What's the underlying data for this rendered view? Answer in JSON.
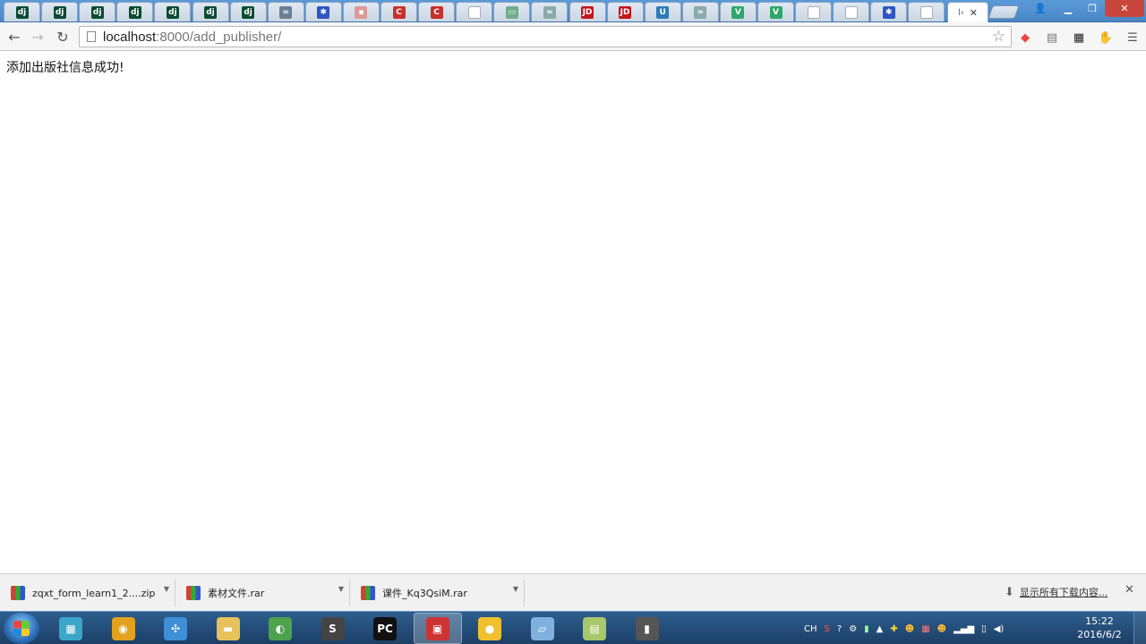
{
  "browser": {
    "tabs": [
      {
        "icon": "django-icon",
        "text": "dj",
        "color": "#0c4b33"
      },
      {
        "icon": "django-icon",
        "text": "dj",
        "color": "#0c4b33"
      },
      {
        "icon": "django-icon",
        "text": "dj",
        "color": "#0c4b33"
      },
      {
        "icon": "django-icon",
        "text": "dj",
        "color": "#0c4b33"
      },
      {
        "icon": "django-icon",
        "text": "dj",
        "color": "#0c4b33"
      },
      {
        "icon": "django-icon",
        "text": "dj",
        "color": "#0c4b33"
      },
      {
        "icon": "django-icon",
        "text": "dj",
        "color": "#0c4b33"
      },
      {
        "icon": "link-icon",
        "text": "∞",
        "color": "#6a7f96"
      },
      {
        "icon": "baidu-paw-icon",
        "text": "✱",
        "color": "#2f55c4"
      },
      {
        "icon": "generic-site-icon",
        "text": "▪",
        "color": "#d99"
      },
      {
        "icon": "csdn-icon",
        "text": "C",
        "color": "#c9302c"
      },
      {
        "icon": "csdn-icon",
        "text": "C",
        "color": "#c9302c"
      },
      {
        "icon": "page-icon",
        "text": "",
        "color": "#d6dde6"
      },
      {
        "icon": "generic-site-icon",
        "text": "▭",
        "color": "#6fae8a"
      },
      {
        "icon": "generic-site-icon",
        "text": "≈",
        "color": "#8aa"
      },
      {
        "icon": "jd-icon",
        "text": "JD",
        "color": "#c4161c"
      },
      {
        "icon": "jd-icon",
        "text": "JD",
        "color": "#c4161c"
      },
      {
        "icon": "u-icon",
        "text": "U",
        "color": "#2b7bb9"
      },
      {
        "icon": "generic-site-icon",
        "text": "≈",
        "color": "#8aa"
      },
      {
        "icon": "vue-icon",
        "text": "V",
        "color": "#2fa66b"
      },
      {
        "icon": "vue-icon",
        "text": "V",
        "color": "#2fa66b"
      },
      {
        "icon": "page-icon",
        "text": "",
        "color": "#d6dde6"
      },
      {
        "icon": "page-icon",
        "text": "",
        "color": "#d6dde6"
      },
      {
        "icon": "baidu-paw-icon",
        "text": "✱",
        "color": "#2f55c4"
      },
      {
        "icon": "page-icon",
        "text": "",
        "color": "#d6dde6"
      }
    ],
    "active_tab_label": "l‹",
    "url_host": "localhost",
    "url_path": ":8000/add_publisher/"
  },
  "page": {
    "message": "添加出版社信息成功!"
  },
  "downloads": {
    "items": [
      {
        "name": "zqxt_form_learn1_2....zip"
      },
      {
        "name": "素材文件.rar"
      },
      {
        "name": "课件_Kq3QsiM.rar"
      }
    ],
    "show_all": "显示所有下载内容..."
  },
  "taskbar": {
    "apps": [
      {
        "name": "store-icon",
        "color": "#3aa7c9",
        "glyph": "▦"
      },
      {
        "name": "chrome-icon",
        "color": "#e2a21e",
        "glyph": "◉"
      },
      {
        "name": "network-icon",
        "color": "#3f8fd6",
        "glyph": "✣"
      },
      {
        "name": "folder-icon",
        "color": "#e7c15a",
        "glyph": "▬"
      },
      {
        "name": "evernote-icon",
        "color": "#4ea24e",
        "glyph": "◐"
      },
      {
        "name": "sublime-icon",
        "color": "#444",
        "glyph": "S"
      },
      {
        "name": "pycharm-icon",
        "color": "#111",
        "glyph": "PC"
      },
      {
        "name": "toolbox-icon",
        "color": "#c33",
        "glyph": "▣"
      },
      {
        "name": "mango-icon",
        "color": "#f0c030",
        "glyph": "●"
      },
      {
        "name": "notepad-icon",
        "color": "#7fb1de",
        "glyph": "▱"
      },
      {
        "name": "notes-icon",
        "color": "#a7c86a",
        "glyph": "▤"
      },
      {
        "name": "recorder-icon",
        "color": "#555",
        "glyph": "▮"
      }
    ],
    "tray_lang": "CH",
    "time": "15:22",
    "date": "2016/6/2"
  }
}
